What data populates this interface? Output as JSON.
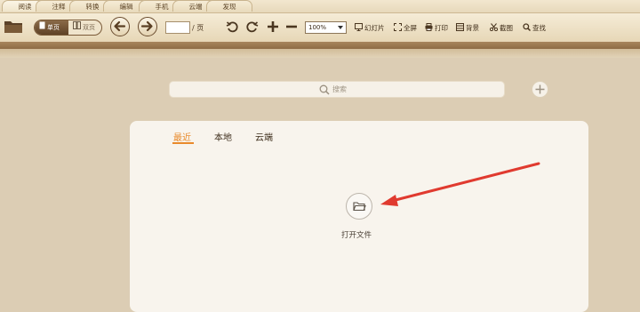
{
  "tabs": [
    {
      "label": "阅读",
      "active": true
    },
    {
      "label": "注释",
      "active": false
    },
    {
      "label": "转换",
      "active": false
    },
    {
      "label": "编辑",
      "active": false
    },
    {
      "label": "手机",
      "active": false
    },
    {
      "label": "云端",
      "active": false
    },
    {
      "label": "发现",
      "active": false
    }
  ],
  "toolbar": {
    "single_page": "单页",
    "double_page": "双页",
    "page_input_value": "",
    "page_suffix": "/ 页",
    "zoom": "100%",
    "slideshow": "幻灯片",
    "fullscreen": "全屏",
    "print": "打印",
    "background": "背景",
    "screenshot": "截图",
    "find": "查找"
  },
  "search": {
    "placeholder": "搜索"
  },
  "panel": {
    "tabs": [
      "最近",
      "本地",
      "云端"
    ],
    "active_tab": "最近",
    "open_file_label": "打开文件"
  },
  "colors": {
    "accent": "#e98a2b",
    "annotation_arrow": "#e03a2f"
  }
}
